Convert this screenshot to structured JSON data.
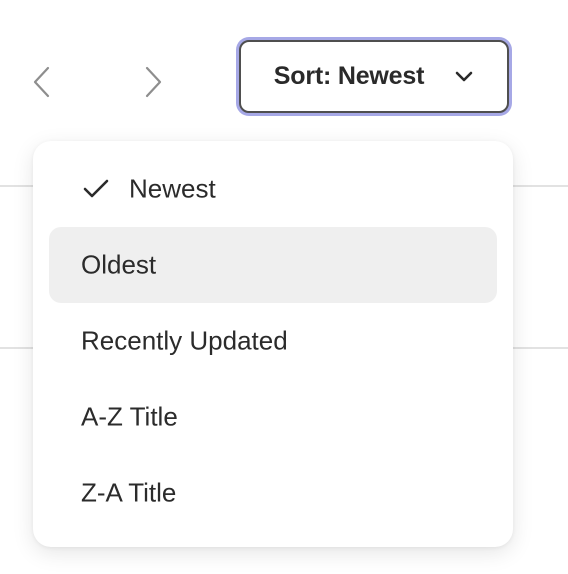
{
  "nav": {
    "prev_icon": "chevron-left-icon",
    "next_icon": "chevron-right-icon"
  },
  "sort": {
    "button_label": "Sort: Newest",
    "dropdown_icon": "chevron-down-icon",
    "focus_ring_color": "#a6a8e6",
    "options": [
      {
        "label": "Newest",
        "selected": true,
        "highlighted": false
      },
      {
        "label": "Oldest",
        "selected": false,
        "highlighted": true
      },
      {
        "label": "Recently Updated",
        "selected": false,
        "highlighted": false
      },
      {
        "label": "A-Z Title",
        "selected": false,
        "highlighted": false
      },
      {
        "label": "Z-A Title",
        "selected": false,
        "highlighted": false
      }
    ]
  },
  "colors": {
    "text": "#2b2b2b",
    "highlight_bg": "#efefef",
    "divider": "#e2e2e2"
  }
}
